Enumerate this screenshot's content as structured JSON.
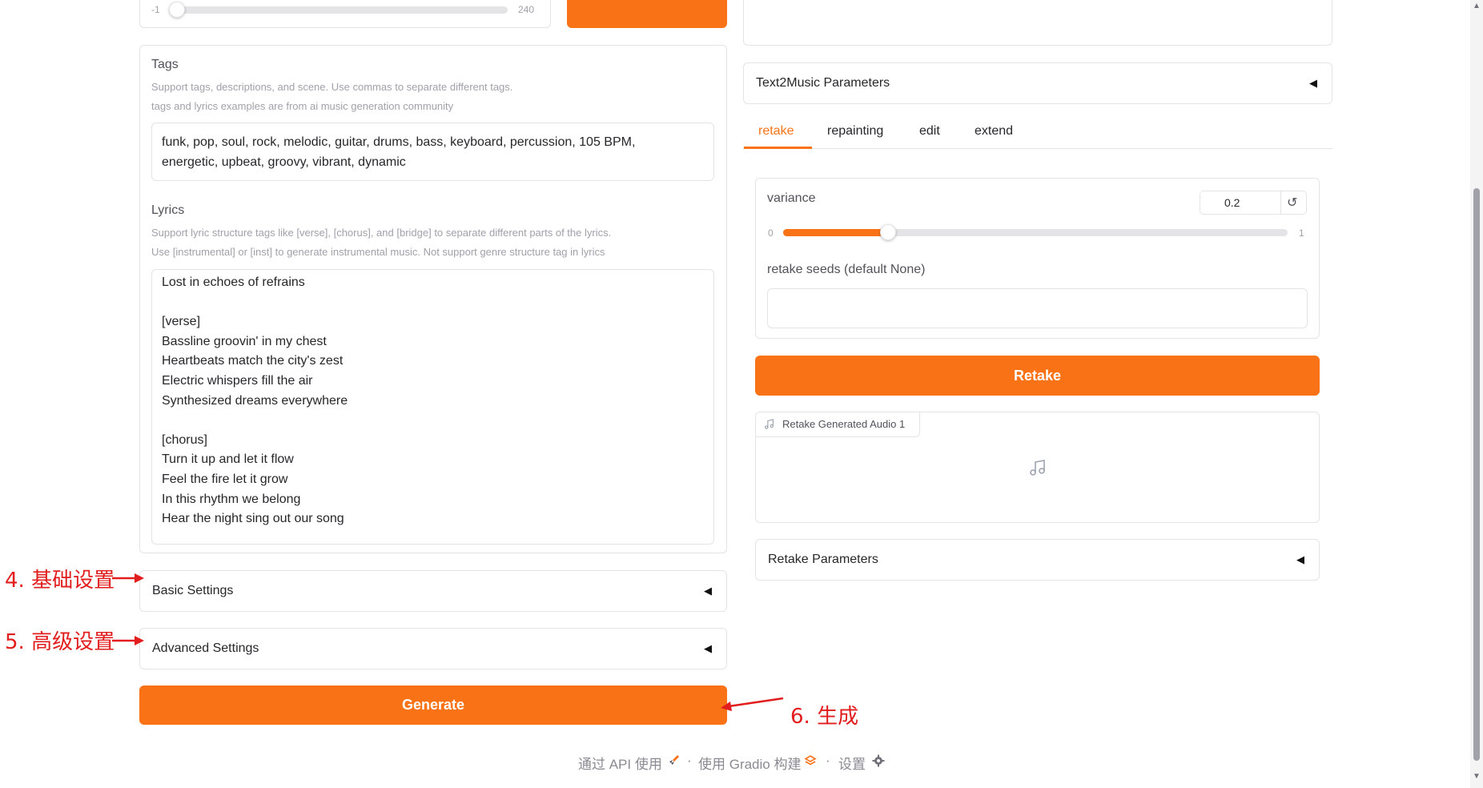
{
  "colors": {
    "accent": "#f97316",
    "annotation": "#e11d1d"
  },
  "duration_slider": {
    "min": "-1",
    "max": "240",
    "value_fraction": 0.0
  },
  "tags": {
    "label": "Tags",
    "info_line1": "Support tags, descriptions, and scene. Use commas to separate different tags.",
    "info_line2": "tags and lyrics examples are from ai music generation community",
    "value": "funk, pop, soul, rock, melodic, guitar, drums, bass, keyboard, percussion, 105 BPM,\nenergetic, upbeat, groovy, vibrant, dynamic"
  },
  "lyrics": {
    "label": "Lyrics",
    "info_line1": "Support lyric structure tags like [verse], [chorus], and [bridge] to separate different parts of the lyrics.",
    "info_line2": "Use [instrumental] or [inst] to generate instrumental music. Not support genre structure tag in lyrics",
    "value": "Lost in echoes of refrains\n\n[verse]\nBassline groovin' in my chest\nHeartbeats match the city's zest\nElectric whispers fill the air\nSynthesized dreams everywhere\n\n[chorus]\nTurn it up and let it flow\nFeel the fire let it grow\nIn this rhythm we belong\nHear the night sing out our song"
  },
  "basic_settings": {
    "label": "Basic Settings",
    "caret": "◀"
  },
  "advanced_settings": {
    "label": "Advanced Settings",
    "caret": "◀"
  },
  "generate_button": {
    "label": "Generate"
  },
  "annotations": {
    "basic": "4. 基础设置",
    "advanced": "5. 高级设置",
    "generate": "6. 生成"
  },
  "text2music_params": {
    "label": "Text2Music Parameters",
    "caret": "◀"
  },
  "tabs": [
    {
      "label": "retake",
      "active": true
    },
    {
      "label": "repainting",
      "active": false
    },
    {
      "label": "edit",
      "active": false
    },
    {
      "label": "extend",
      "active": false
    }
  ],
  "variance": {
    "label": "variance",
    "value": "0.2",
    "min": "0",
    "max": "1",
    "value_fraction": 0.2,
    "reset_icon": "↺"
  },
  "retake_seeds": {
    "label": "retake seeds (default None)",
    "value": ""
  },
  "retake_button": {
    "label": "Retake"
  },
  "retake_audio": {
    "label": "Retake Generated Audio 1",
    "icon": "music-note-icon"
  },
  "retake_params": {
    "label": "Retake Parameters",
    "caret": "◀"
  },
  "footer": {
    "api": "通过 API 使用",
    "built": "使用 Gradio 构建",
    "settings": "设置",
    "separator": "·"
  }
}
